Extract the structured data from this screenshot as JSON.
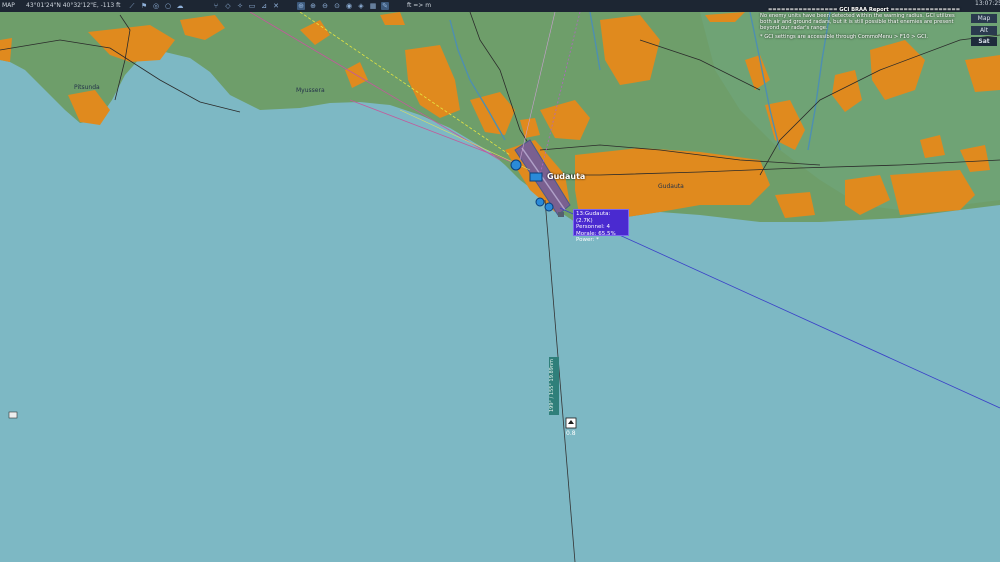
{
  "topbar": {
    "mode": "MAP",
    "coordinates": "43°01'24\"N 40°32'12\"E, -113 ft",
    "scale_label": "ft => m",
    "time": "13:07:25",
    "icons": [
      "route-icon",
      "flag-icon",
      "view-icon",
      "circle-icon",
      "cloud-icon",
      "tree-icon",
      "diamond-icon",
      "satellite-icon",
      "unit-icon",
      "ruler-icon",
      "crosshair-icon",
      "zoom-in-icon",
      "zoom-out-icon",
      "zoom-fit-icon",
      "zoom-area-icon",
      "layer-icon",
      "globe-icon",
      "grid-icon",
      "brush-icon"
    ]
  },
  "gci_report": {
    "header": "================ GCI BRAA Report ================",
    "line1": "No enemy units have been detected within the warning radius. GCI utilizes both air and ground radars, but it is still possible that enemies are present beyond our radar's range.",
    "line2": "* GCI settings are accessible through CommoMenu > F10 > GCI."
  },
  "map_modes": {
    "alt": "Alt",
    "map": "Map",
    "sat": "Sat",
    "selected": "Sat"
  },
  "places": {
    "pitsunda": "Pitsunda",
    "myussera": "Myussera",
    "gudauta_big": "Gudauta",
    "gudauta_town": "Gudauta"
  },
  "airbase_tooltip": {
    "name": "13:Gudauta: (2.7K)",
    "personnel": "Personnel: 4",
    "morale": "Morale: 65.5%",
    "power": "Power: *"
  },
  "ruler": {
    "label": "199° / 155° 19.89nm"
  },
  "unit": {
    "label": "0.8"
  },
  "colors": {
    "sea": "#7db8c4",
    "land": "#6e9e6a",
    "urban": "#e08a1e",
    "tooltip": "#4a2ad0",
    "toolbar": "#1d2633"
  }
}
